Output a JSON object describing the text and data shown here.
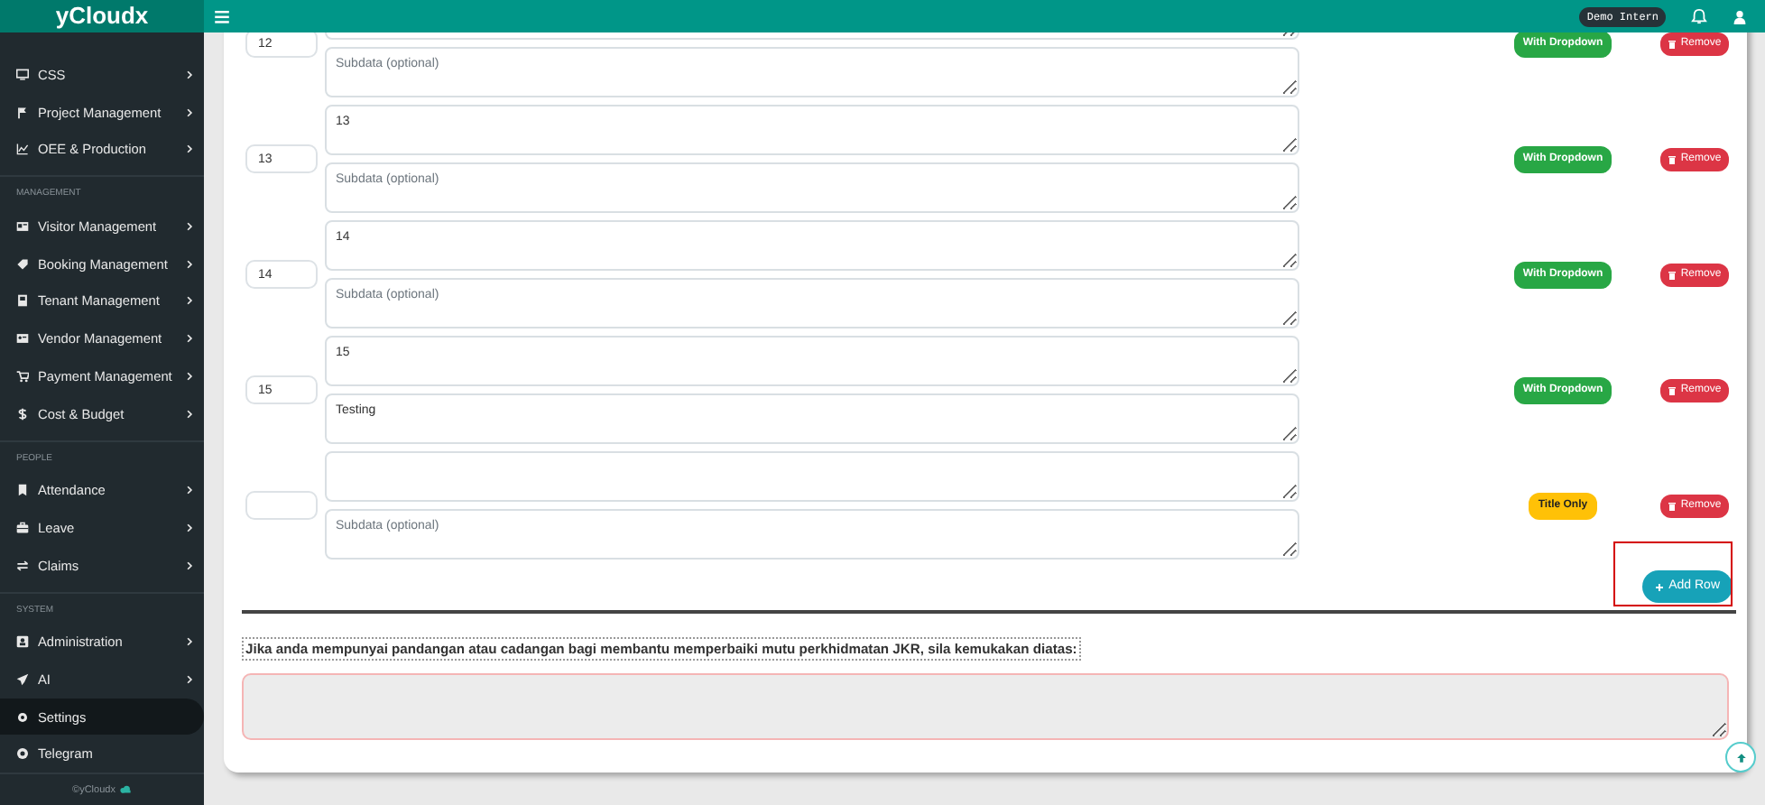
{
  "brand": "yCloudx",
  "topbar": {
    "user_badge": "Demo Intern"
  },
  "sidebar": {
    "groups": [
      {
        "items": [
          {
            "label": "CSS",
            "has_submenu": true,
            "selected": false
          },
          {
            "label": "Project Management",
            "has_submenu": true,
            "selected": false
          },
          {
            "label": "OEE & Production",
            "has_submenu": true,
            "selected": false
          }
        ]
      },
      {
        "heading": "MANAGEMENT",
        "items": [
          {
            "label": "Visitor Management",
            "has_submenu": true,
            "selected": false
          },
          {
            "label": "Booking Management",
            "has_submenu": true,
            "selected": false
          },
          {
            "label": "Tenant Management",
            "has_submenu": true,
            "selected": false
          },
          {
            "label": "Vendor Management",
            "has_submenu": true,
            "selected": false
          },
          {
            "label": "Payment Management",
            "has_submenu": true,
            "selected": false
          },
          {
            "label": "Cost & Budget",
            "has_submenu": true,
            "selected": false
          }
        ]
      },
      {
        "heading": "PEOPLE",
        "items": [
          {
            "label": "Attendance",
            "has_submenu": true,
            "selected": false
          },
          {
            "label": "Leave",
            "has_submenu": true,
            "selected": false
          },
          {
            "label": "Claims",
            "has_submenu": true,
            "selected": false
          }
        ]
      },
      {
        "heading": "SYSTEM",
        "items": [
          {
            "label": "Administration",
            "has_submenu": true,
            "selected": false
          },
          {
            "label": "AI",
            "has_submenu": true,
            "selected": false
          },
          {
            "label": "Settings",
            "has_submenu": false,
            "selected": true
          },
          {
            "label": "Telegram",
            "has_submenu": false,
            "selected": false
          }
        ]
      }
    ],
    "footer": "©yCloudx"
  },
  "rows": [
    {
      "number": "12",
      "subdata": {
        "placeholder": "Subdata (optional)"
      },
      "kind": "dropdown",
      "badge": "With Dropdown",
      "remove": "Remove"
    },
    {
      "number": "13",
      "title": "13",
      "subdata": {
        "placeholder": "Subdata (optional)"
      },
      "kind": "dropdown",
      "badge": "With Dropdown",
      "remove": "Remove"
    },
    {
      "number": "14",
      "title": "14",
      "subdata": {
        "placeholder": "Subdata (optional)"
      },
      "kind": "dropdown",
      "badge": "With Dropdown",
      "remove": "Remove"
    },
    {
      "number": "15",
      "title": "15",
      "subdata": {
        "value": "Testing"
      },
      "kind": "dropdown",
      "badge": "With Dropdown",
      "remove": "Remove"
    },
    {
      "subdata": {
        "placeholder": "Subdata (optional)"
      },
      "kind": "title",
      "badge": "Title Only",
      "remove": "Remove"
    }
  ],
  "add_row": {
    "label": "Add Row",
    "highlighted": true
  },
  "feedback": {
    "label": "Jika anda mempunyai pandangan atau cadangan bagi membantu memperbaiki mutu perkhidmatan JKR, sila kemukakan diatas:"
  }
}
